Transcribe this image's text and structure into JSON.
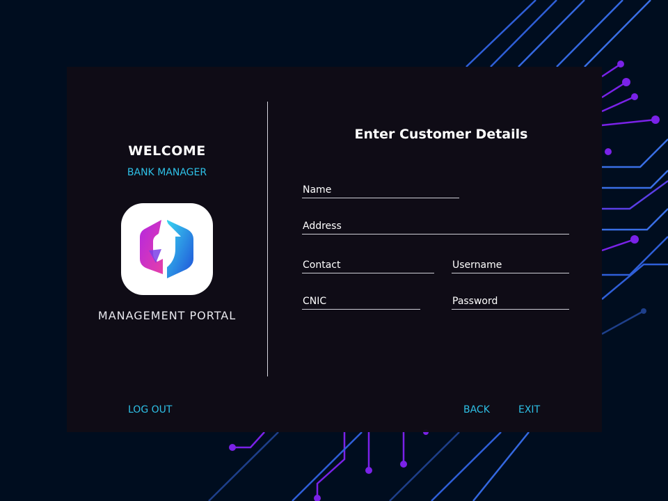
{
  "sidebar": {
    "welcome": "WELCOME",
    "role": "BANK MANAGER",
    "portal": "MANAGEMENT PORTAL"
  },
  "form": {
    "title": "Enter Customer Details",
    "fields": {
      "name": "Name",
      "address": "Address",
      "contact": "Contact",
      "username": "Username",
      "cnic": "CNIC",
      "password": "Password"
    }
  },
  "footer": {
    "logout": "LOG OUT",
    "back": "BACK",
    "exit": "EXIT"
  },
  "colors": {
    "background": "#000d1f",
    "panel": "#100c16",
    "accent": "#2ec0e6",
    "circuit_blue": "#3d6fe0",
    "circuit_purple": "#7a22e8"
  }
}
